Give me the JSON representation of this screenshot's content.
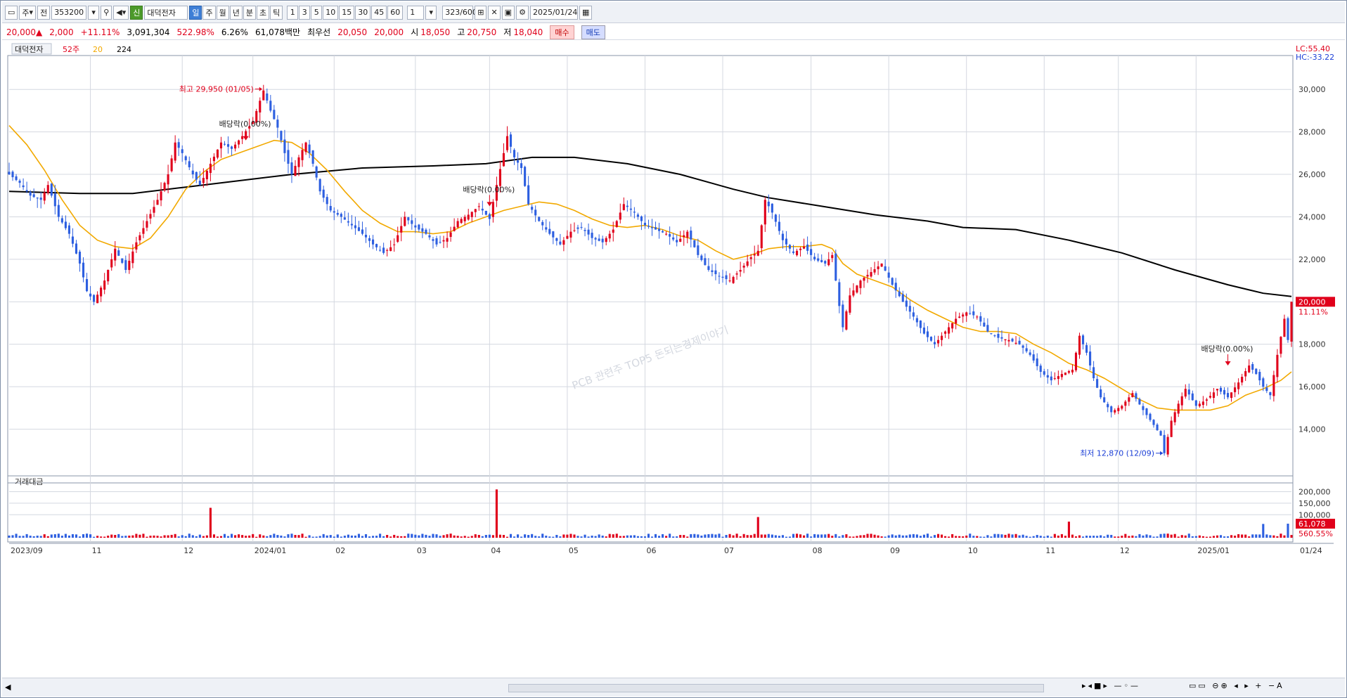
{
  "toolbar": {
    "type_select": "주",
    "market_label": "전",
    "code": "353200",
    "name": "대덕전자",
    "name_badge": "신",
    "periods": [
      "일",
      "주",
      "월",
      "년",
      "분",
      "초",
      "틱"
    ],
    "active_period": "일",
    "intervals": [
      "1",
      "3",
      "5",
      "10",
      "15",
      "30",
      "45",
      "60"
    ],
    "unit_value": "1",
    "count": "323/600",
    "date": "2025/01/24"
  },
  "quote": {
    "price": "20,000▲",
    "change": "2,000",
    "change_pct": "+11.11%",
    "volume": "3,091,304",
    "volume_ratio": "522.98%",
    "turnover": "6.26%",
    "amount": "61,078백만",
    "best_label": "최우선",
    "best_ask": "20,050",
    "best_bid": "20,000",
    "open_label": "시",
    "open": "18,050",
    "high_label": "고",
    "high": "20,750",
    "low_label": "저",
    "low": "18,040",
    "buy_label": "매수",
    "sell_label": "매도"
  },
  "legend": {
    "name": "대덕전자",
    "items": [
      {
        "label": "52주",
        "color": "#e0001b"
      },
      {
        "label": "20",
        "color": "#f2a900"
      },
      {
        "label": "224",
        "color": "#000000"
      }
    ],
    "lc_text": "LC:55.40",
    "hc_text": "HC:-33.22",
    "last_price_label": "20,000",
    "last_change_label": "11.11%",
    "last_amount_label": "61,078",
    "last_amount_pct": "560.55%"
  },
  "volume_panel": {
    "title": "거래대금"
  },
  "watermark": "PCB 관련주 TOP5 돈되는경제이야기",
  "colors": {
    "up": "#e0001b",
    "down": "#2d5fe0",
    "ma20": "#f2a900",
    "ma224": "#000000",
    "grid": "#d4d8e0"
  },
  "chart_data": {
    "type": "candlestick",
    "title": "대덕전자",
    "price_axis": {
      "ticks": [
        14000,
        16000,
        18000,
        20000,
        22000,
        24000,
        26000,
        28000,
        30000
      ],
      "labels": [
        "14,000",
        "16,000",
        "18,000",
        "20,000",
        "22,000",
        "24,000",
        "26,000",
        "28,000",
        "30,000"
      ],
      "ylim": [
        12000,
        31000
      ]
    },
    "volume_axis": {
      "ticks": [
        100000,
        150000,
        200000
      ],
      "labels": [
        "100,000",
        "150,000",
        "200,000"
      ],
      "ylim": [
        0,
        220000
      ]
    },
    "time_axis": [
      "2023/09",
      "11",
      "12",
      "2024/01",
      "02",
      "03",
      "04",
      "05",
      "06",
      "07",
      "08",
      "09",
      "10",
      "11",
      "12",
      "2025/01",
      "01/24"
    ],
    "price_path": [
      [
        0,
        26000
      ],
      [
        3,
        25600
      ],
      [
        6,
        25000
      ],
      [
        9,
        24800
      ],
      [
        11,
        25500
      ],
      [
        14,
        24000
      ],
      [
        17,
        23200
      ],
      [
        20,
        21800
      ],
      [
        22,
        20500
      ],
      [
        24,
        20000
      ],
      [
        27,
        21000
      ],
      [
        30,
        22500
      ],
      [
        33,
        21500
      ],
      [
        36,
        22800
      ],
      [
        39,
        23800
      ],
      [
        42,
        24800
      ],
      [
        45,
        26000
      ],
      [
        47,
        27500
      ],
      [
        49,
        27000
      ],
      [
        52,
        26000
      ],
      [
        54,
        25500
      ],
      [
        57,
        26500
      ],
      [
        60,
        27500
      ],
      [
        63,
        27200
      ],
      [
        66,
        27800
      ],
      [
        69,
        28500
      ],
      [
        72,
        29950
      ],
      [
        74,
        29000
      ],
      [
        76,
        28200
      ],
      [
        78,
        27000
      ],
      [
        80,
        26000
      ],
      [
        82,
        26800
      ],
      [
        84,
        27500
      ],
      [
        86,
        26500
      ],
      [
        88,
        25200
      ],
      [
        91,
        24300
      ],
      [
        94,
        24000
      ],
      [
        97,
        23600
      ],
      [
        100,
        23200
      ],
      [
        103,
        22700
      ],
      [
        106,
        22300
      ],
      [
        109,
        22700
      ],
      [
        112,
        24000
      ],
      [
        115,
        23500
      ],
      [
        118,
        23200
      ],
      [
        121,
        22700
      ],
      [
        124,
        23000
      ],
      [
        127,
        23800
      ],
      [
        130,
        24100
      ],
      [
        133,
        24500
      ],
      [
        136,
        23900
      ],
      [
        138,
        25500
      ],
      [
        140,
        27000
      ],
      [
        141,
        27800
      ],
      [
        143,
        26800
      ],
      [
        145,
        26300
      ],
      [
        147,
        24600
      ],
      [
        150,
        23800
      ],
      [
        153,
        23200
      ],
      [
        156,
        22700
      ],
      [
        159,
        23300
      ],
      [
        162,
        23500
      ],
      [
        165,
        23000
      ],
      [
        168,
        22800
      ],
      [
        171,
        23400
      ],
      [
        174,
        24600
      ],
      [
        177,
        24200
      ],
      [
        180,
        23600
      ],
      [
        183,
        23400
      ],
      [
        186,
        23200
      ],
      [
        189,
        22800
      ],
      [
        192,
        23300
      ],
      [
        195,
        22200
      ],
      [
        198,
        21500
      ],
      [
        201,
        21200
      ],
      [
        204,
        21000
      ],
      [
        207,
        21500
      ],
      [
        210,
        22100
      ],
      [
        212,
        22400
      ],
      [
        214,
        24800
      ],
      [
        216,
        24200
      ],
      [
        219,
        22900
      ],
      [
        222,
        22300
      ],
      [
        225,
        22600
      ],
      [
        228,
        22000
      ],
      [
        231,
        21800
      ],
      [
        233,
        22200
      ],
      [
        235,
        19800
      ],
      [
        236,
        18800
      ],
      [
        238,
        20300
      ],
      [
        241,
        21000
      ],
      [
        244,
        21400
      ],
      [
        247,
        21800
      ],
      [
        250,
        20800
      ],
      [
        253,
        20000
      ],
      [
        256,
        19300
      ],
      [
        259,
        18500
      ],
      [
        262,
        18000
      ],
      [
        265,
        18600
      ],
      [
        268,
        19200
      ],
      [
        271,
        19500
      ],
      [
        274,
        19300
      ],
      [
        277,
        18600
      ],
      [
        280,
        18300
      ],
      [
        283,
        18200
      ],
      [
        286,
        18000
      ],
      [
        289,
        17500
      ],
      [
        292,
        16700
      ],
      [
        295,
        16300
      ],
      [
        298,
        16600
      ],
      [
        301,
        16800
      ],
      [
        303,
        18400
      ],
      [
        305,
        17600
      ],
      [
        307,
        16400
      ],
      [
        309,
        15500
      ],
      [
        312,
        14800
      ],
      [
        315,
        15100
      ],
      [
        318,
        15700
      ],
      [
        321,
        14900
      ],
      [
        324,
        14200
      ],
      [
        326,
        13700
      ],
      [
        327,
        12870
      ],
      [
        329,
        14400
      ],
      [
        331,
        15200
      ],
      [
        333,
        15900
      ],
      [
        336,
        15100
      ],
      [
        339,
        15400
      ],
      [
        342,
        15900
      ],
      [
        345,
        15500
      ],
      [
        348,
        16200
      ],
      [
        351,
        17000
      ],
      [
        353,
        16600
      ],
      [
        355,
        16000
      ],
      [
        357,
        15600
      ],
      [
        359,
        17500
      ],
      [
        361,
        19200
      ],
      [
        362,
        18200
      ],
      [
        363,
        20000
      ]
    ],
    "ma20_path": [
      [
        0,
        28300
      ],
      [
        5,
        27400
      ],
      [
        10,
        26200
      ],
      [
        15,
        24800
      ],
      [
        20,
        23600
      ],
      [
        25,
        22900
      ],
      [
        30,
        22600
      ],
      [
        35,
        22500
      ],
      [
        40,
        23000
      ],
      [
        45,
        24000
      ],
      [
        50,
        25300
      ],
      [
        55,
        26100
      ],
      [
        60,
        26700
      ],
      [
        65,
        27000
      ],
      [
        70,
        27300
      ],
      [
        75,
        27600
      ],
      [
        80,
        27500
      ],
      [
        85,
        27000
      ],
      [
        90,
        26200
      ],
      [
        95,
        25200
      ],
      [
        100,
        24300
      ],
      [
        105,
        23700
      ],
      [
        110,
        23300
      ],
      [
        115,
        23300
      ],
      [
        120,
        23200
      ],
      [
        125,
        23300
      ],
      [
        130,
        23700
      ],
      [
        135,
        24000
      ],
      [
        140,
        24300
      ],
      [
        145,
        24500
      ],
      [
        150,
        24700
      ],
      [
        155,
        24600
      ],
      [
        160,
        24300
      ],
      [
        165,
        23900
      ],
      [
        170,
        23600
      ],
      [
        175,
        23500
      ],
      [
        180,
        23600
      ],
      [
        185,
        23400
      ],
      [
        190,
        23100
      ],
      [
        195,
        22900
      ],
      [
        200,
        22400
      ],
      [
        205,
        22000
      ],
      [
        210,
        22200
      ],
      [
        215,
        22500
      ],
      [
        220,
        22600
      ],
      [
        225,
        22600
      ],
      [
        230,
        22700
      ],
      [
        233,
        22500
      ],
      [
        236,
        21800
      ],
      [
        240,
        21300
      ],
      [
        245,
        21000
      ],
      [
        250,
        20700
      ],
      [
        255,
        20100
      ],
      [
        260,
        19600
      ],
      [
        265,
        19200
      ],
      [
        270,
        18800
      ],
      [
        275,
        18600
      ],
      [
        280,
        18600
      ],
      [
        285,
        18500
      ],
      [
        290,
        18000
      ],
      [
        295,
        17600
      ],
      [
        300,
        17100
      ],
      [
        305,
        16800
      ],
      [
        310,
        16400
      ],
      [
        315,
        15900
      ],
      [
        320,
        15400
      ],
      [
        325,
        15000
      ],
      [
        330,
        14900
      ],
      [
        335,
        14900
      ],
      [
        340,
        14900
      ],
      [
        345,
        15100
      ],
      [
        350,
        15600
      ],
      [
        355,
        15900
      ],
      [
        360,
        16300
      ],
      [
        363,
        16700
      ]
    ],
    "ma224_path": [
      [
        0,
        25200
      ],
      [
        20,
        25100
      ],
      [
        35,
        25100
      ],
      [
        50,
        25400
      ],
      [
        65,
        25700
      ],
      [
        80,
        26000
      ],
      [
        100,
        26300
      ],
      [
        120,
        26400
      ],
      [
        135,
        26500
      ],
      [
        148,
        26800
      ],
      [
        160,
        26800
      ],
      [
        175,
        26500
      ],
      [
        190,
        26000
      ],
      [
        205,
        25300
      ],
      [
        215,
        24900
      ],
      [
        230,
        24500
      ],
      [
        245,
        24100
      ],
      [
        260,
        23800
      ],
      [
        270,
        23500
      ],
      [
        285,
        23400
      ],
      [
        300,
        22900
      ],
      [
        315,
        22300
      ],
      [
        330,
        21500
      ],
      [
        345,
        20800
      ],
      [
        355,
        20400
      ],
      [
        363,
        20250
      ]
    ],
    "volume_spikes": [
      [
        57,
        130000
      ],
      [
        138,
        210000
      ],
      [
        212,
        90000
      ],
      [
        300,
        70000
      ],
      [
        355,
        60000
      ],
      [
        362,
        61078
      ]
    ],
    "annotations": [
      {
        "text": "최고 29,950 (01/05)",
        "color": "#e0001b",
        "x": 72,
        "y": 29950,
        "side": "left"
      },
      {
        "text": "최저 12,870 (12/09)",
        "color": "#1c3fd6",
        "x": 327,
        "y": 12870,
        "side": "left"
      },
      {
        "text": "배당락(0.00%)",
        "color": "#222222",
        "x": 67,
        "y": 27400,
        "side": "marker"
      },
      {
        "text": "배당락(0.00%)",
        "color": "#222222",
        "x": 136,
        "y": 24300,
        "side": "marker"
      },
      {
        "text": "배당락(0.00%)",
        "color": "#222222",
        "x": 345,
        "y": 16800,
        "side": "marker"
      }
    ]
  }
}
